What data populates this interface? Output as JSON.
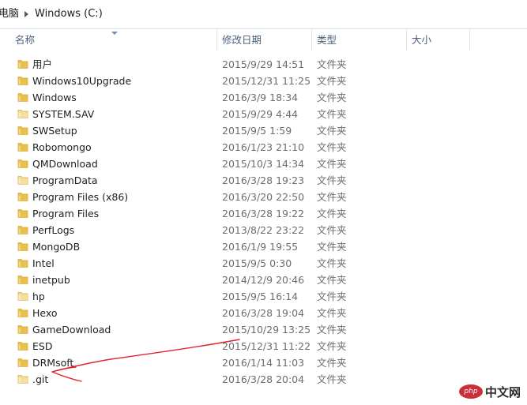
{
  "breadcrumb": {
    "items": [
      "电脑",
      "Windows (C:)"
    ]
  },
  "columns": {
    "name": "名称",
    "modified": "修改日期",
    "type": "类型",
    "size": "大小"
  },
  "files": [
    {
      "name": "用户",
      "modified": "2015/9/29 14:51",
      "type": "文件夹",
      "hidden": false
    },
    {
      "name": "Windows10Upgrade",
      "modified": "2015/12/31 11:25",
      "type": "文件夹",
      "hidden": false
    },
    {
      "name": "Windows",
      "modified": "2016/3/9 18:34",
      "type": "文件夹",
      "hidden": false
    },
    {
      "name": "SYSTEM.SAV",
      "modified": "2015/9/29 4:44",
      "type": "文件夹",
      "hidden": true
    },
    {
      "name": "SWSetup",
      "modified": "2015/9/5 1:59",
      "type": "文件夹",
      "hidden": false
    },
    {
      "name": "Robomongo",
      "modified": "2016/1/23 21:10",
      "type": "文件夹",
      "hidden": false
    },
    {
      "name": "QMDownload",
      "modified": "2015/10/3 14:34",
      "type": "文件夹",
      "hidden": false
    },
    {
      "name": "ProgramData",
      "modified": "2016/3/28 19:23",
      "type": "文件夹",
      "hidden": true
    },
    {
      "name": "Program Files (x86)",
      "modified": "2016/3/20 22:50",
      "type": "文件夹",
      "hidden": false
    },
    {
      "name": "Program Files",
      "modified": "2016/3/28 19:22",
      "type": "文件夹",
      "hidden": false
    },
    {
      "name": "PerfLogs",
      "modified": "2013/8/22 23:22",
      "type": "文件夹",
      "hidden": false
    },
    {
      "name": "MongoDB",
      "modified": "2016/1/9 19:55",
      "type": "文件夹",
      "hidden": false
    },
    {
      "name": "Intel",
      "modified": "2015/9/5 0:30",
      "type": "文件夹",
      "hidden": false
    },
    {
      "name": "inetpub",
      "modified": "2014/12/9 20:46",
      "type": "文件夹",
      "hidden": false
    },
    {
      "name": "hp",
      "modified": "2015/9/5 16:14",
      "type": "文件夹",
      "hidden": true
    },
    {
      "name": "Hexo",
      "modified": "2016/3/28 19:04",
      "type": "文件夹",
      "hidden": false
    },
    {
      "name": "GameDownload",
      "modified": "2015/10/29 13:25",
      "type": "文件夹",
      "hidden": false
    },
    {
      "name": "ESD",
      "modified": "2015/12/31 11:22",
      "type": "文件夹",
      "hidden": false
    },
    {
      "name": "DRMsoft",
      "modified": "2016/1/14 11:03",
      "type": "文件夹",
      "hidden": false
    },
    {
      "name": ".git",
      "modified": "2016/3/28 20:04",
      "type": "文件夹",
      "hidden": true
    }
  ],
  "colors": {
    "folder_fill": "#e8bf4b",
    "folder_tab": "#d9a930",
    "folder_hidden_fill": "#f3dea2",
    "annotation_stroke": "#e0242c",
    "header_text": "#4c607a",
    "secondary_text": "#6d6d6d"
  },
  "watermark": {
    "badge": "php",
    "text": "中文网"
  }
}
